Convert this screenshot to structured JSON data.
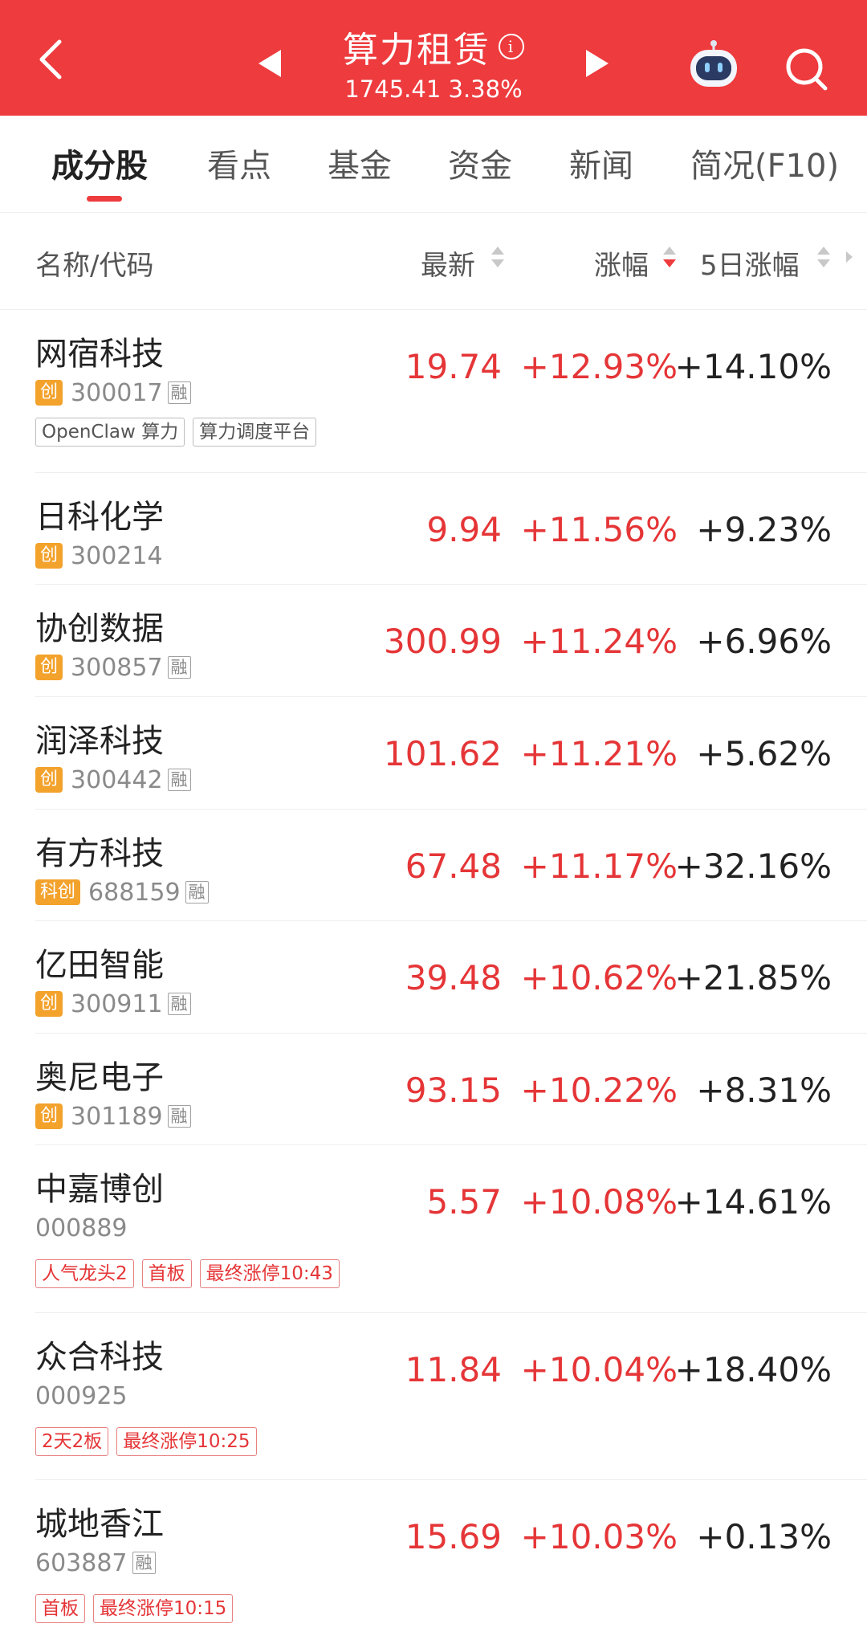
{
  "header": {
    "title": "算力租赁",
    "info": "i",
    "index_value": "1745.41 3.38%"
  },
  "tabs": [
    "成分股",
    "看点",
    "基金",
    "资金",
    "新闻",
    "简况(F10)"
  ],
  "columns": {
    "name": "名称/代码",
    "price": "最新",
    "change": "涨幅",
    "change5d": "5日涨幅"
  },
  "stocks": [
    {
      "name": "网宿科技",
      "board": "创",
      "code": "300017",
      "margin": "融",
      "price": "19.74",
      "change": "+12.93%",
      "change5d": "+14.10%",
      "tags": [
        {
          "text": "OpenClaw 算力"
        },
        {
          "text": "算力调度平台"
        }
      ]
    },
    {
      "name": "日科化学",
      "board": "创",
      "code": "300214",
      "margin": "",
      "price": "9.94",
      "change": "+11.56%",
      "change5d": "+9.23%",
      "tags": []
    },
    {
      "name": "协创数据",
      "board": "创",
      "code": "300857",
      "margin": "融",
      "price": "300.99",
      "change": "+11.24%",
      "change5d": "+6.96%",
      "tags": []
    },
    {
      "name": "润泽科技",
      "board": "创",
      "code": "300442",
      "margin": "融",
      "price": "101.62",
      "change": "+11.21%",
      "change5d": "+5.62%",
      "tags": []
    },
    {
      "name": "有方科技",
      "board": "科创",
      "code": "688159",
      "margin": "融",
      "price": "67.48",
      "change": "+11.17%",
      "change5d": "+32.16%",
      "tags": []
    },
    {
      "name": "亿田智能",
      "board": "创",
      "code": "300911",
      "margin": "融",
      "price": "39.48",
      "change": "+10.62%",
      "change5d": "+21.85%",
      "tags": []
    },
    {
      "name": "奥尼电子",
      "board": "创",
      "code": "301189",
      "margin": "融",
      "price": "93.15",
      "change": "+10.22%",
      "change5d": "+8.31%",
      "tags": []
    },
    {
      "name": "中嘉博创",
      "board": "",
      "code": "000889",
      "margin": "",
      "price": "5.57",
      "change": "+10.08%",
      "change5d": "+14.61%",
      "tags": [
        {
          "text": "人气龙头2"
        },
        {
          "text": "首板"
        },
        {
          "text": "最终涨停10:43"
        }
      ]
    },
    {
      "name": "众合科技",
      "board": "",
      "code": "000925",
      "margin": "",
      "price": "11.84",
      "change": "+10.04%",
      "change5d": "+18.40%",
      "tags": [
        {
          "text": "2天2板"
        },
        {
          "text": "最终涨停10:25"
        }
      ]
    },
    {
      "name": "城地香江",
      "board": "",
      "code": "603887",
      "margin": "融",
      "price": "15.69",
      "change": "+10.03%",
      "change5d": "+0.13%",
      "tags": [
        {
          "text": "首板"
        },
        {
          "text": "最终涨停10:15"
        }
      ]
    }
  ],
  "colors": {
    "header": "#ee3b3e",
    "up": "#e53537",
    "badge": "#f3a22c"
  }
}
